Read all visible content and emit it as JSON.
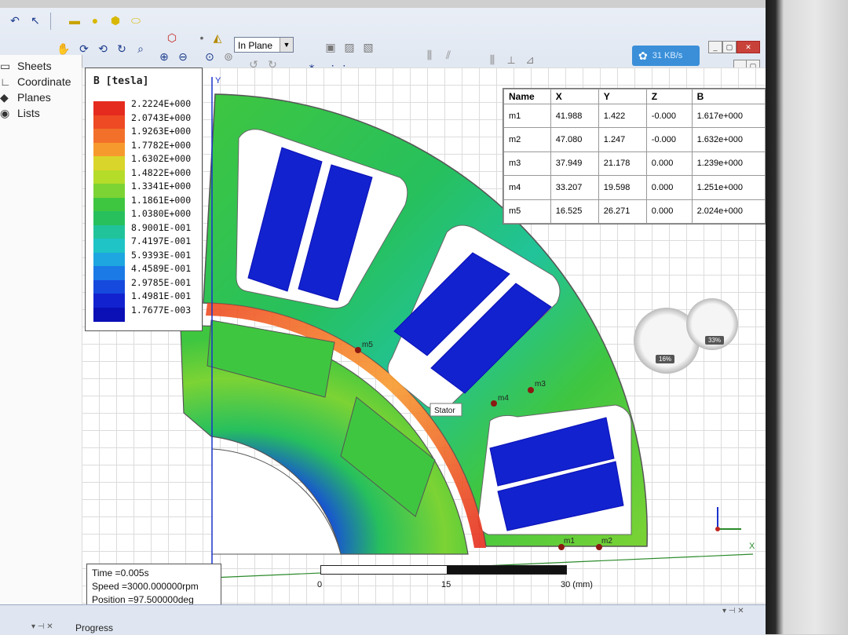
{
  "toolbar": {
    "plane_select_value": "In Plane",
    "speed_text": "31 KB/s"
  },
  "tree": {
    "items": [
      {
        "label": "Sheets",
        "icon": "sheet-icon"
      },
      {
        "label": "Coordinate",
        "icon": "axes-icon"
      },
      {
        "label": "Planes",
        "icon": "plane-icon"
      },
      {
        "label": "Lists",
        "icon": "list-icon"
      }
    ]
  },
  "legend": {
    "title": "B [tesla]",
    "entries": [
      {
        "value": "2.2224E+000",
        "color": "#e52b1e"
      },
      {
        "value": "2.0743E+000",
        "color": "#ee4a23"
      },
      {
        "value": "1.9263E+000",
        "color": "#f2702a"
      },
      {
        "value": "1.7782E+000",
        "color": "#f79a2e"
      },
      {
        "value": "1.6302E+000",
        "color": "#d9d52a"
      },
      {
        "value": "1.4822E+000",
        "color": "#b6dc2a"
      },
      {
        "value": "1.3341E+000",
        "color": "#7cd334"
      },
      {
        "value": "1.1861E+000",
        "color": "#3fc640"
      },
      {
        "value": "1.0380E+000",
        "color": "#27c05d"
      },
      {
        "value": "8.9001E-001",
        "color": "#21c39a"
      },
      {
        "value": "7.4197E-001",
        "color": "#1fc4c6"
      },
      {
        "value": "5.9393E-001",
        "color": "#1ea6e0"
      },
      {
        "value": "4.4589E-001",
        "color": "#1b7ae6"
      },
      {
        "value": "2.9785E-001",
        "color": "#1649dd"
      },
      {
        "value": "1.4981E-001",
        "color": "#1222cf"
      },
      {
        "value": "1.7677E-003",
        "color": "#0a10b5"
      }
    ]
  },
  "markers_table": {
    "headers": [
      "Name",
      "X",
      "Y",
      "Z",
      "B"
    ],
    "rows": [
      [
        "m1",
        "41.988",
        "1.422",
        "-0.000",
        "1.617e+000"
      ],
      [
        "m2",
        "47.080",
        "1.247",
        "-0.000",
        "1.632e+000"
      ],
      [
        "m3",
        "37.949",
        "21.178",
        "0.000",
        "1.239e+000"
      ],
      [
        "m4",
        "33.207",
        "19.598",
        "0.000",
        "1.251e+000"
      ],
      [
        "m5",
        "16.525",
        "26.271",
        "0.000",
        "2.024e+000"
      ]
    ]
  },
  "plot": {
    "axis_y_label": "Y",
    "axis_x_label": "X",
    "tooltip": "Stator",
    "marker_labels": [
      "m1",
      "m2",
      "m3",
      "m4",
      "m5"
    ]
  },
  "status": {
    "time": "Time    =0.005s",
    "speed": "Speed   =3000.000000rpm",
    "position": "Position =97.500000deg"
  },
  "scale": {
    "labels": [
      "0",
      "15",
      "30 (mm)"
    ]
  },
  "gauges": {
    "left_percent": "16%",
    "right_percent": "33%"
  },
  "bottom": {
    "progress_label": "Progress"
  }
}
